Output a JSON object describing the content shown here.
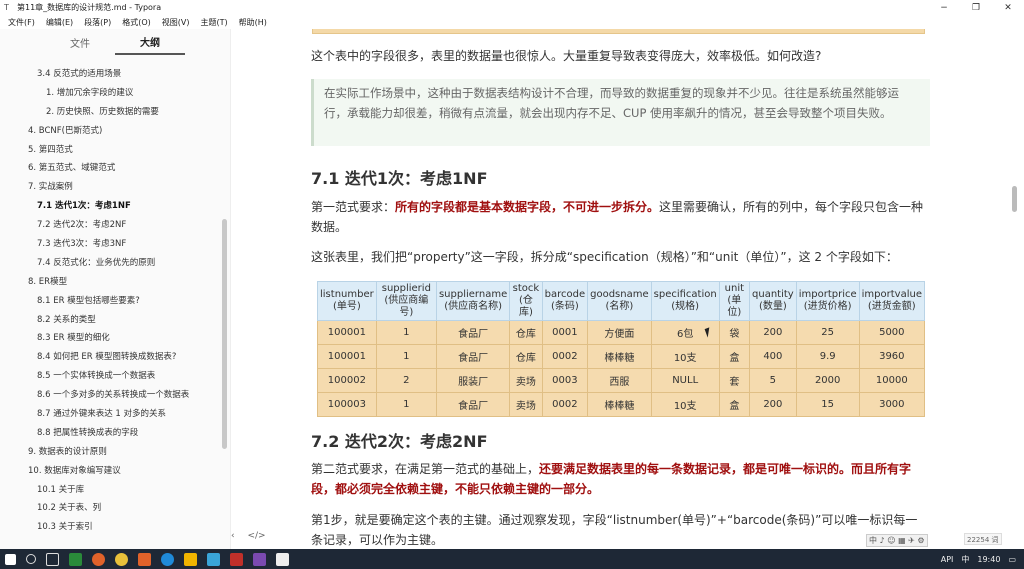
{
  "window": {
    "title": "第11章_数据库的设计规范.md - Typora",
    "minimize": "−",
    "maximize": "❐",
    "close": "✕"
  },
  "menu": [
    "文件(F)",
    "编辑(E)",
    "段落(P)",
    "格式(O)",
    "视图(V)",
    "主题(T)",
    "帮助(H)"
  ],
  "sidebar": {
    "tabs": [
      "文件",
      "大纲"
    ],
    "active_tab": "大纲",
    "items": [
      {
        "label": "3.4 反范式的适用场景",
        "level": 2
      },
      {
        "label": "1. 增加冗余字段的建议",
        "level": 3
      },
      {
        "label": "2. 历史快照、历史数据的需要",
        "level": 3
      },
      {
        "label": "4. BCNF(巴斯范式)",
        "level": 1
      },
      {
        "label": "5. 第四范式",
        "level": 1
      },
      {
        "label": "6. 第五范式、域键范式",
        "level": 1
      },
      {
        "label": "7. 实战案例",
        "level": 1
      },
      {
        "label": "7.1 迭代1次：考虑1NF",
        "level": 2,
        "active": true
      },
      {
        "label": "7.2 迭代2次：考虑2NF",
        "level": 2
      },
      {
        "label": "7.3 迭代3次：考虑3NF",
        "level": 2
      },
      {
        "label": "7.4 反范式化：业务优先的原则",
        "level": 2
      },
      {
        "label": "8. ER模型",
        "level": 1
      },
      {
        "label": "8.1 ER 模型包括哪些要素?",
        "level": 2
      },
      {
        "label": "8.2 关系的类型",
        "level": 2
      },
      {
        "label": "8.3 ER 模型的细化",
        "level": 2
      },
      {
        "label": "8.4 如何把 ER 模型图转换成数据表?",
        "level": 2
      },
      {
        "label": "8.5 一个实体转换成一个数据表",
        "level": 2
      },
      {
        "label": "8.6 一个多对多的关系转换成一个数据表",
        "level": 2
      },
      {
        "label": "8.7 通过外键来表达 1 对多的关系",
        "level": 2
      },
      {
        "label": "8.8 把属性转换成表的字段",
        "level": 2
      },
      {
        "label": "9. 数据表的设计原则",
        "level": 1
      },
      {
        "label": "10. 数据库对象编写建议",
        "level": 1
      },
      {
        "label": "10.1 关于库",
        "level": 2
      },
      {
        "label": "10.2 关于表、列",
        "level": 2
      },
      {
        "label": "10.3 关于索引",
        "level": 2
      }
    ],
    "footer_left": "‹",
    "footer_right": "</>"
  },
  "content": {
    "p1": "这个表中的字段很多，表里的数据量也很惊人。大量重复导致表变得庞大，效率极低。如何改造?",
    "quote": "在实际工作场景中，这种由于数据表结构设计不合理，而导致的数据重复的现象并不少见。往往是系统虽然能够运行，承载能力却很差，稍微有点流量，就会出现内存不足、CUP 使用率飙升的情况，甚至会导致整个项目失败。",
    "h_71": "7.1 迭代1次：考虑1NF",
    "p2_plain": "第一范式要求：",
    "p2_bold": "所有的字段都是基本数据字段，不可进一步拆分。",
    "p2_rest": "这里需要确认，所有的列中，每个字段只包含一种数据。",
    "p3": "这张表里，我们把“property”这一字段，拆分成“specification（规格）”和“unit（单位）”，这 2 个字段如下：",
    "h_72": "7.2 迭代2次：考虑2NF",
    "p4_plain": "第二范式要求，在满足第一范式的基础上，",
    "p4_bold": "还要满足数据表里的每一条数据记录，都是可唯一标识的。而且所有字段，都必须完全依赖主键，不能只依赖主键的一部分。",
    "p5": "第1步，就是要确定这个表的主键。通过观察发现，字段“listnumber(单号)”+“barcode(条码)”可以唯一标识每一条记录，可以作为主键。"
  },
  "table": {
    "headers": [
      [
        "listnumber",
        "(单号)"
      ],
      [
        "supplierid",
        "(供应商编号)"
      ],
      [
        "suppliername",
        "(供应商名称)"
      ],
      [
        "stock",
        "(仓库)"
      ],
      [
        "barcode",
        "(条码)"
      ],
      [
        "goodsname",
        "(名称)"
      ],
      [
        "specification",
        "(规格)"
      ],
      [
        "unit",
        "(单位)"
      ],
      [
        "quantity",
        "(数量)"
      ],
      [
        "importprice",
        "(进货价格)"
      ],
      [
        "importvalue",
        "(进货金额)"
      ]
    ],
    "rows": [
      [
        "100001",
        "1",
        "食品厂",
        "仓库",
        "0001",
        "方便面",
        "6包",
        "袋",
        "200",
        "25",
        "5000"
      ],
      [
        "100001",
        "1",
        "食品厂",
        "仓库",
        "0002",
        "棒棒糖",
        "10支",
        "盒",
        "400",
        "9.9",
        "3960"
      ],
      [
        "100002",
        "2",
        "服装厂",
        "卖场",
        "0003",
        "西服",
        "NULL",
        "套",
        "5",
        "2000",
        "10000"
      ],
      [
        "100003",
        "1",
        "食品厂",
        "卖场",
        "0002",
        "棒棒糖",
        "10支",
        "盒",
        "200",
        "15",
        "3000"
      ]
    ]
  },
  "status": {
    "wordcount": "22254 词",
    "ime": "中 ♪ ☺ ▦ ✈ ⚙"
  },
  "taskbar": {
    "tray_text": "API",
    "time": "19:40",
    "lang": "中"
  },
  "colors": {
    "table_header_bg": "#dcecf7",
    "table_cell_bg": "#f5dbaf",
    "emphasis_red": "#a01010",
    "taskbar_bg": "#1e2836"
  }
}
